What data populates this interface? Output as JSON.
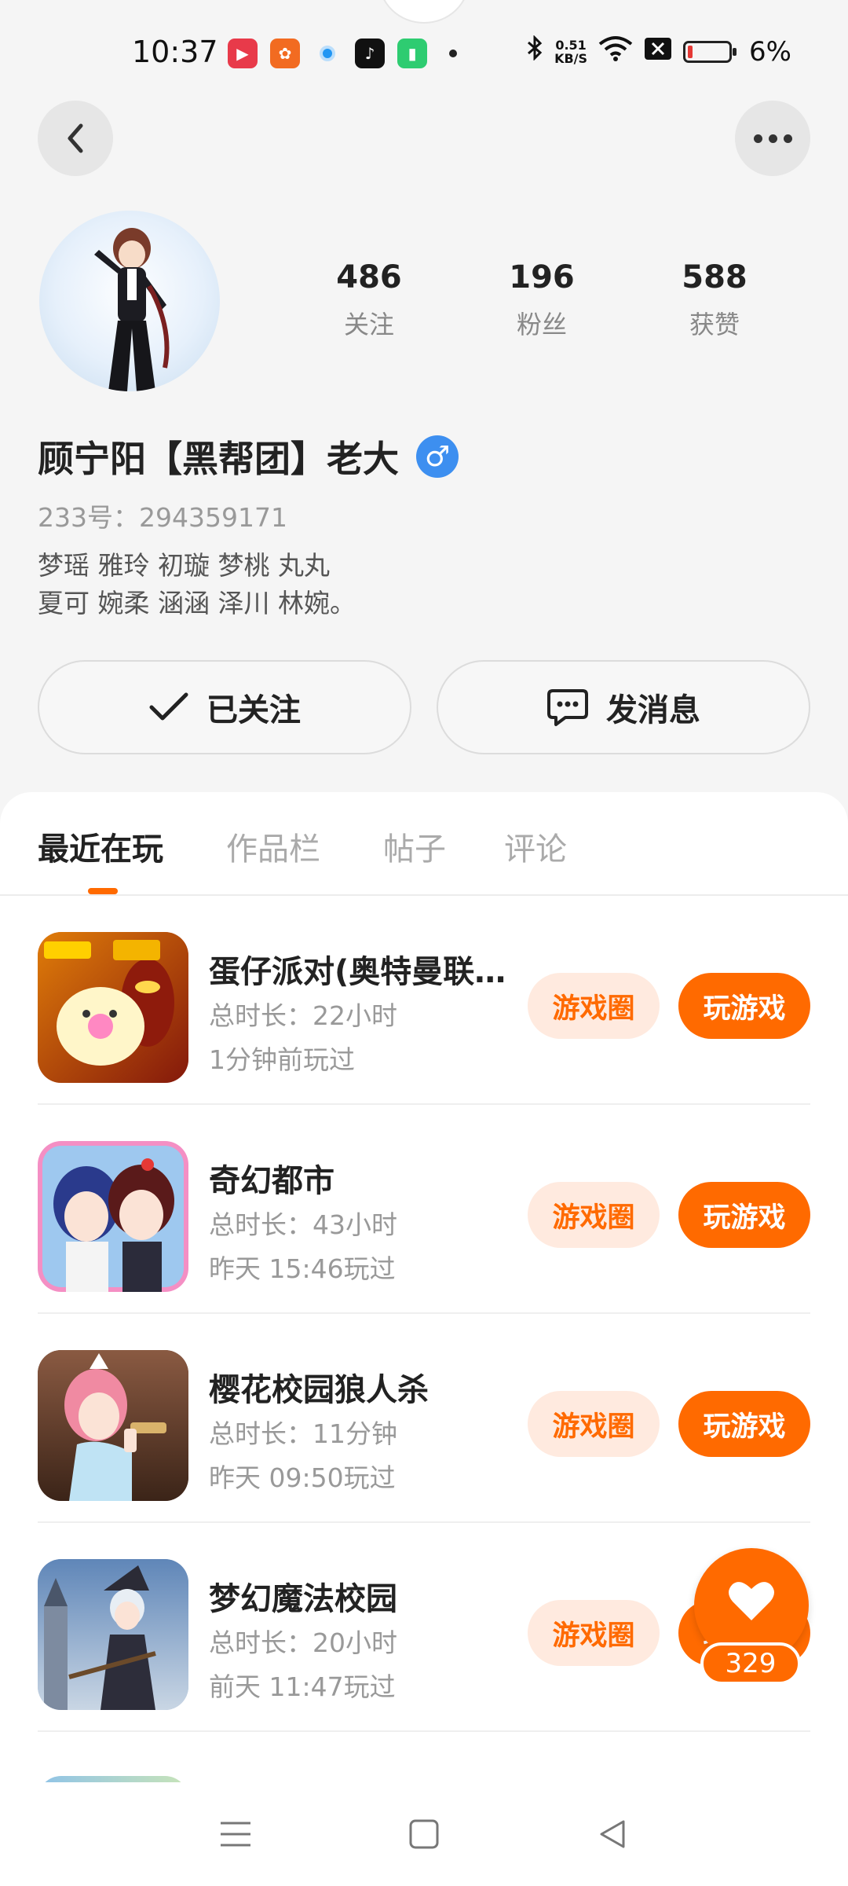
{
  "status_bar": {
    "time": "10:37",
    "net_speed_value": "0.51",
    "net_speed_unit": "KB/S",
    "battery": "6%"
  },
  "profile": {
    "stats": [
      {
        "num": "486",
        "label": "关注"
      },
      {
        "num": "196",
        "label": "粉丝"
      },
      {
        "num": "588",
        "label": "获赞"
      }
    ],
    "name": "顾宁阳【黑帮团】老大",
    "gender_symbol": "♂",
    "uid": "233号：294359171",
    "bio_line1": "梦瑶 雅玲 初璇 梦桃 丸丸",
    "bio_line2": "夏可 婉柔 涵涵 泽川 林婉。"
  },
  "actions": {
    "follow_label": "已关注",
    "message_label": "发消息"
  },
  "tabs": [
    "最近在玩",
    "作品栏",
    "帖子",
    "评论"
  ],
  "games": [
    {
      "title": "蛋仔派对(奥特曼联…",
      "duration": "总时长：22小时",
      "last_played": "1分钟前玩过",
      "circle_label": "游戏圈",
      "play_label": "玩游戏"
    },
    {
      "title": "奇幻都市",
      "duration": "总时长：43小时",
      "last_played": "昨天 15:46玩过",
      "circle_label": "游戏圈",
      "play_label": "玩游戏"
    },
    {
      "title": "樱花校园狼人杀",
      "duration": "总时长：11分钟",
      "last_played": "昨天 09:50玩过",
      "circle_label": "游戏圈",
      "play_label": "玩游戏"
    },
    {
      "title": "梦幻魔法校园",
      "duration": "总时长：20小时",
      "last_played": "前天 11:47玩过",
      "circle_label": "游戏圈",
      "play_label": "玩游戏"
    }
  ],
  "like": {
    "count": "329"
  },
  "colors": {
    "accent": "#ff6a00",
    "accent_light": "#ffeadf",
    "gender_blue": "#3d8ff0"
  }
}
